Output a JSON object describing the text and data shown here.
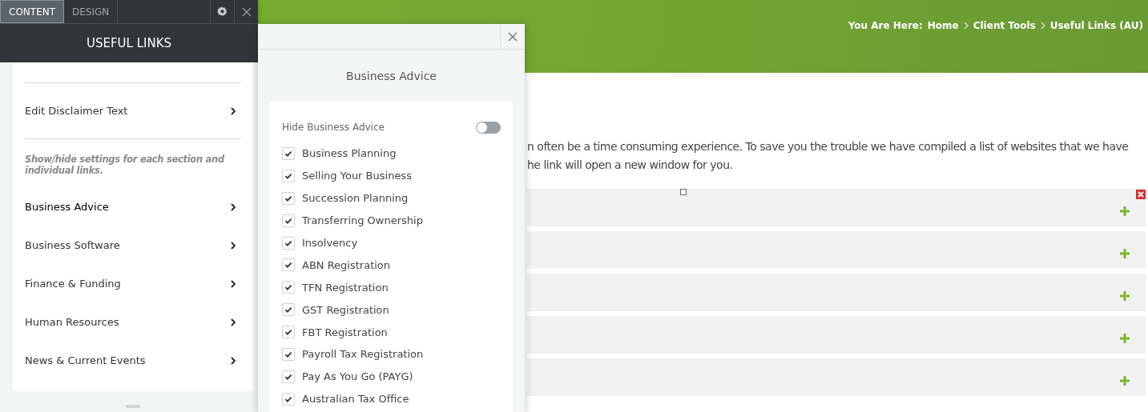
{
  "editor": {
    "tabs": [
      {
        "label": "CONTENT",
        "selected": true
      },
      {
        "label": "DESIGN",
        "selected": false
      }
    ],
    "title": "USEFUL LINKS",
    "items": [
      {
        "label": "Edit Disclaimer Text",
        "selected": false
      }
    ],
    "note": "Show/hide settings for each section and individual links.",
    "sections": [
      {
        "label": "Business Advice",
        "selected": true
      },
      {
        "label": "Business Software",
        "selected": false
      },
      {
        "label": "Finance & Funding",
        "selected": false
      },
      {
        "label": "Human Resources",
        "selected": false
      },
      {
        "label": "News & Current Events",
        "selected": false
      }
    ]
  },
  "popup": {
    "title": "Business Advice",
    "hide_toggle": {
      "label": "Hide Business Advice",
      "on": false
    },
    "links": [
      {
        "label": "Business Planning",
        "checked": true
      },
      {
        "label": "Selling Your Business",
        "checked": true
      },
      {
        "label": "Succession Planning",
        "checked": true
      },
      {
        "label": "Transferring Ownership",
        "checked": true
      },
      {
        "label": "Insolvency",
        "checked": true
      },
      {
        "label": "ABN Registration",
        "checked": true
      },
      {
        "label": "TFN Registration",
        "checked": true
      },
      {
        "label": "GST Registration",
        "checked": true
      },
      {
        "label": "FBT Registration",
        "checked": true
      },
      {
        "label": "Payroll Tax Registration",
        "checked": true
      },
      {
        "label": "Pay As You Go (PAYG)",
        "checked": true
      },
      {
        "label": "Australian Tax Office",
        "checked": true
      }
    ]
  },
  "page": {
    "breadcrumb": {
      "prefix": "You Are Here:",
      "items": [
        "Home",
        "Client Tools",
        "Useful Links (AU)"
      ]
    },
    "intro": [
      "n often be a time consuming experience. To save you the trouble we have compiled a list of websites that we have",
      "he link will open a new window for you."
    ],
    "accordion": [
      {
        "expanded": false
      },
      {
        "expanded": false
      },
      {
        "expanded": false
      },
      {
        "expanded": false
      },
      {
        "expanded": false
      }
    ]
  }
}
